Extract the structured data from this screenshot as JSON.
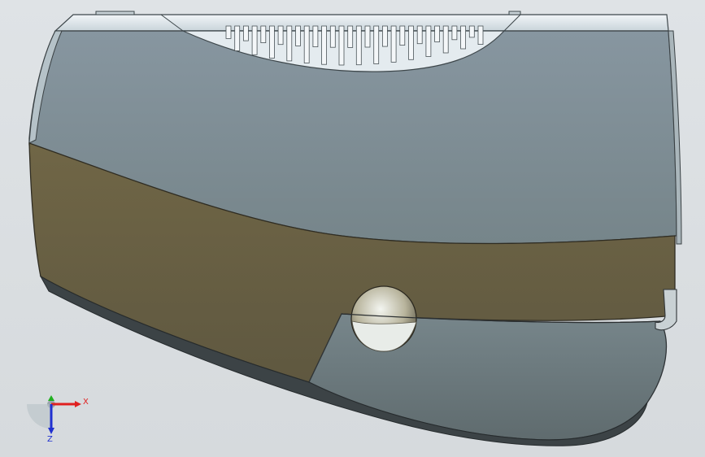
{
  "viewport": {
    "background": "#d9dde0"
  },
  "model": {
    "colors": {
      "grey_body": "#7b8a8e",
      "olive_band": "#6b6246",
      "top_rail": "#d9e3e8",
      "vent_fill": "#e2e9ee",
      "lower_grey": "#6e7d80"
    }
  },
  "triad": {
    "x_label": "X",
    "z_label": "Z",
    "x_color": "#e02020",
    "y_color": "#20b020",
    "z_color": "#2030d0"
  }
}
